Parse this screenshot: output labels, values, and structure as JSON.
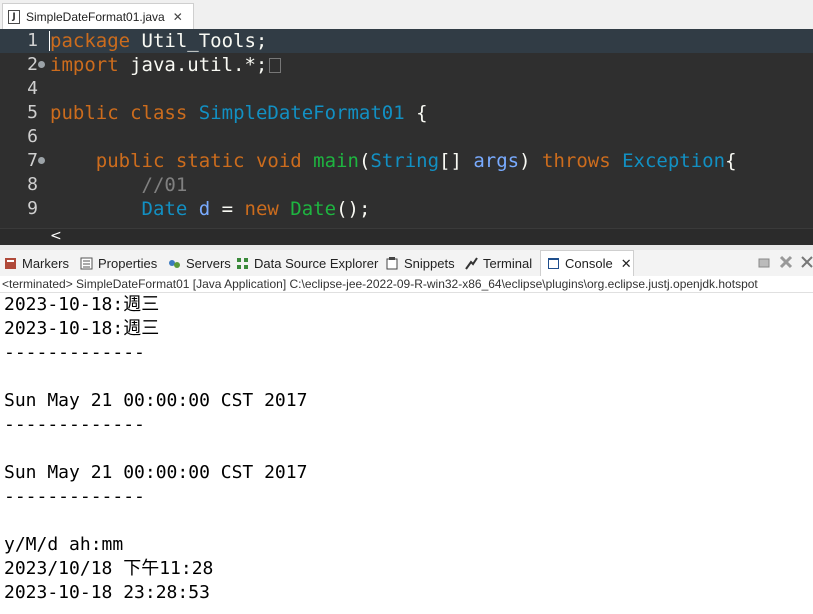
{
  "editor_tab": {
    "label": "SimpleDateFormat01.java",
    "close": "✕"
  },
  "code_lines": [
    {
      "num": "1",
      "tokens": [
        [
          "kw",
          "package"
        ],
        [
          "plain",
          " Util_Tools;"
        ]
      ]
    },
    {
      "num": "2",
      "tokens": [
        [
          "kw",
          "import"
        ],
        [
          "plain",
          " java.util.*;"
        ]
      ]
    },
    {
      "num": "4",
      "tokens": []
    },
    {
      "num": "5",
      "tokens": [
        [
          "kw",
          "public"
        ],
        [
          "plain",
          " "
        ],
        [
          "kw",
          "class"
        ],
        [
          "plain",
          " "
        ],
        [
          "cls",
          "SimpleDateFormat01"
        ],
        [
          "plain",
          " {"
        ]
      ]
    },
    {
      "num": "6",
      "tokens": []
    },
    {
      "num": "7",
      "tokens": [
        [
          "plain",
          "    "
        ],
        [
          "kw",
          "public"
        ],
        [
          "plain",
          " "
        ],
        [
          "kw",
          "static"
        ],
        [
          "plain",
          " "
        ],
        [
          "kw",
          "void"
        ],
        [
          "plain",
          " "
        ],
        [
          "fn",
          "main"
        ],
        [
          "plain",
          "("
        ],
        [
          "cls",
          "String"
        ],
        [
          "plain",
          "[] "
        ],
        [
          "param",
          "args"
        ],
        [
          "plain",
          ") "
        ],
        [
          "kw",
          "throws"
        ],
        [
          "plain",
          " "
        ],
        [
          "cls",
          "Exception"
        ],
        [
          "plain",
          "{"
        ]
      ]
    },
    {
      "num": "8",
      "tokens": [
        [
          "plain",
          "        "
        ],
        [
          "cmt",
          "//01"
        ]
      ]
    },
    {
      "num": "9",
      "tokens": [
        [
          "plain",
          "        "
        ],
        [
          "cls",
          "Date"
        ],
        [
          "plain",
          " "
        ],
        [
          "param",
          "d"
        ],
        [
          "plain",
          " = "
        ],
        [
          "kw",
          "new"
        ],
        [
          "plain",
          " "
        ],
        [
          "fn",
          "Date"
        ],
        [
          "plain",
          "();"
        ]
      ]
    }
  ],
  "scroll": {
    "left_arrow": "<"
  },
  "view_tabs": {
    "markers": "Markers",
    "properties": "Properties",
    "servers": "Servers",
    "data_source_explorer": "Data Source Explorer",
    "snippets": "Snippets",
    "terminal": "Terminal",
    "console": "Console",
    "console_close": "✕"
  },
  "console_status": "<terminated> SimpleDateFormat01 [Java Application] C:\\eclipse-jee-2022-09-R-win32-x86_64\\eclipse\\plugins\\org.eclipse.justj.openjdk.hotspot",
  "console_output": [
    "2023-10-18:週三",
    "2023-10-18:週三",
    "-------------",
    "",
    "Sun May 21 00:00:00 CST 2017",
    "-------------",
    "",
    "Sun May 21 00:00:00 CST 2017",
    "-------------",
    "",
    "y/M/d ah:mm",
    "2023/10/18 下午11:28",
    "2023-10-18 23:28:53"
  ],
  "colors": {
    "editor_bg": "#2f2f2f",
    "keyword": "#cc6c1d",
    "class": "#1290c3",
    "method": "#1eb540",
    "variable": "#79abff",
    "comment": "#808080"
  }
}
